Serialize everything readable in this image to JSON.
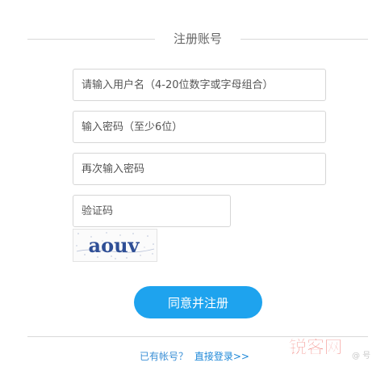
{
  "form": {
    "title": "注册账号",
    "username_placeholder": "请输入用户名（4-20位数字或字母组合）",
    "password_placeholder": "输入密码（至少6位）",
    "confirm_placeholder": "再次输入密码",
    "captcha_placeholder": "验证码",
    "captcha_text": "aouv",
    "submit_label": "同意并注册"
  },
  "footer": {
    "question": "已有帐号？",
    "login_link": "直接登录>>"
  },
  "watermark": {
    "brand": "锐客网",
    "extra": "@ 号"
  },
  "colors": {
    "accent": "#1ea3ee",
    "link": "#1e88d8",
    "watermark_red": "#e8332a"
  }
}
